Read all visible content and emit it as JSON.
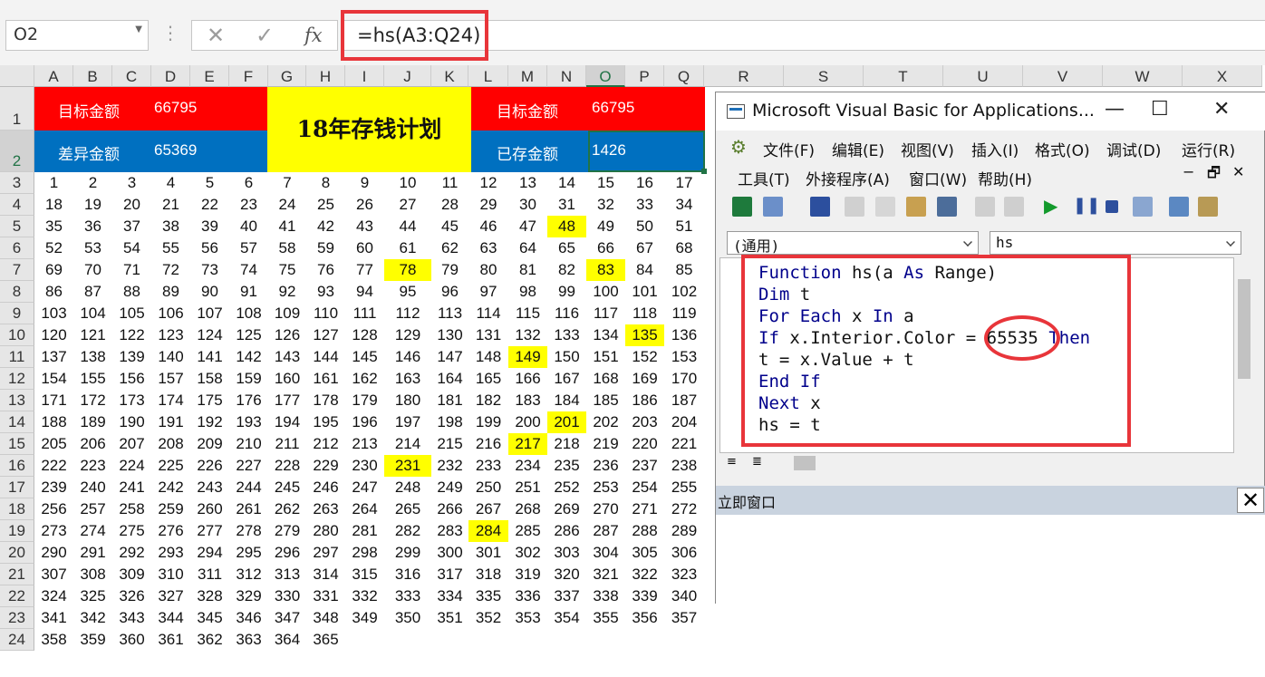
{
  "formula_bar": {
    "name_box": "O2",
    "cancel_glyph": "✕",
    "enter_glyph": "✓",
    "fx_label": "fx",
    "formula": "=hs(A3:Q24)"
  },
  "columns": [
    "A",
    "B",
    "C",
    "D",
    "E",
    "F",
    "G",
    "H",
    "I",
    "J",
    "K",
    "L",
    "M",
    "N",
    "O",
    "P",
    "Q",
    "R",
    "S",
    "T",
    "U",
    "V",
    "W",
    "X"
  ],
  "rows": [
    "1",
    "2",
    "3",
    "4",
    "5",
    "6",
    "7",
    "8",
    "9",
    "10",
    "11",
    "12",
    "13",
    "14",
    "15",
    "16",
    "17",
    "18",
    "19",
    "20",
    "21",
    "22",
    "23",
    "24"
  ],
  "selected_cell": "O2",
  "sheet_header": {
    "target_label_1": "目标金额",
    "target_value_1": "66795",
    "diff_label": "差异金额",
    "diff_value": "65369",
    "title": "18年存钱计划",
    "target_label_2": "目标金额",
    "target_value_2": "66795",
    "saved_label": "已存金额",
    "saved_value": "1426"
  },
  "grid_numbers": {
    "first": 1,
    "last": 365,
    "per_row": 17,
    "highlighted": [
      48,
      78,
      83,
      135,
      149,
      201,
      217,
      231,
      284
    ]
  },
  "colors": {
    "red_fill": "#ff0000",
    "blue_fill": "#0070c0",
    "yellow_fill": "#ffff00",
    "annotation_red": "#e8353a"
  },
  "vbe": {
    "title": "Microsoft Visual Basic for Applications...",
    "window_buttons": [
      "—",
      "☐",
      "✕"
    ],
    "menu_row1": [
      "文件(F)",
      "编辑(E)",
      "视图(V)",
      "插入(I)",
      "格式(O)",
      "调试(D)",
      "运行(R)"
    ],
    "menu_row2": [
      "工具(T)",
      "外接程序(A)",
      "窗口(W)",
      "帮助(H)"
    ],
    "child_buttons": [
      "−",
      "🗗",
      "✕"
    ],
    "object_combo": "(通用)",
    "proc_combo": "hs",
    "code": [
      {
        "kw": "Function",
        "rest": " hs(a ",
        "kw2": "As",
        "rest2": " Range)"
      },
      {
        "kw": "Dim",
        "rest": " t"
      },
      {
        "kw": "For Each",
        "rest": " x ",
        "kw2": "In",
        "rest2": " a"
      },
      {
        "kw": "If",
        "rest": " x.Interior.Color = 65535 ",
        "kw2": "Then",
        "rest2": ""
      },
      {
        "kw": "",
        "rest": "t = x.Value + t"
      },
      {
        "kw": "End If",
        "rest": ""
      },
      {
        "kw": "Next",
        "rest": " x"
      },
      {
        "kw": "",
        "rest": "hs = t"
      }
    ],
    "immediate_title": "立即窗口"
  }
}
